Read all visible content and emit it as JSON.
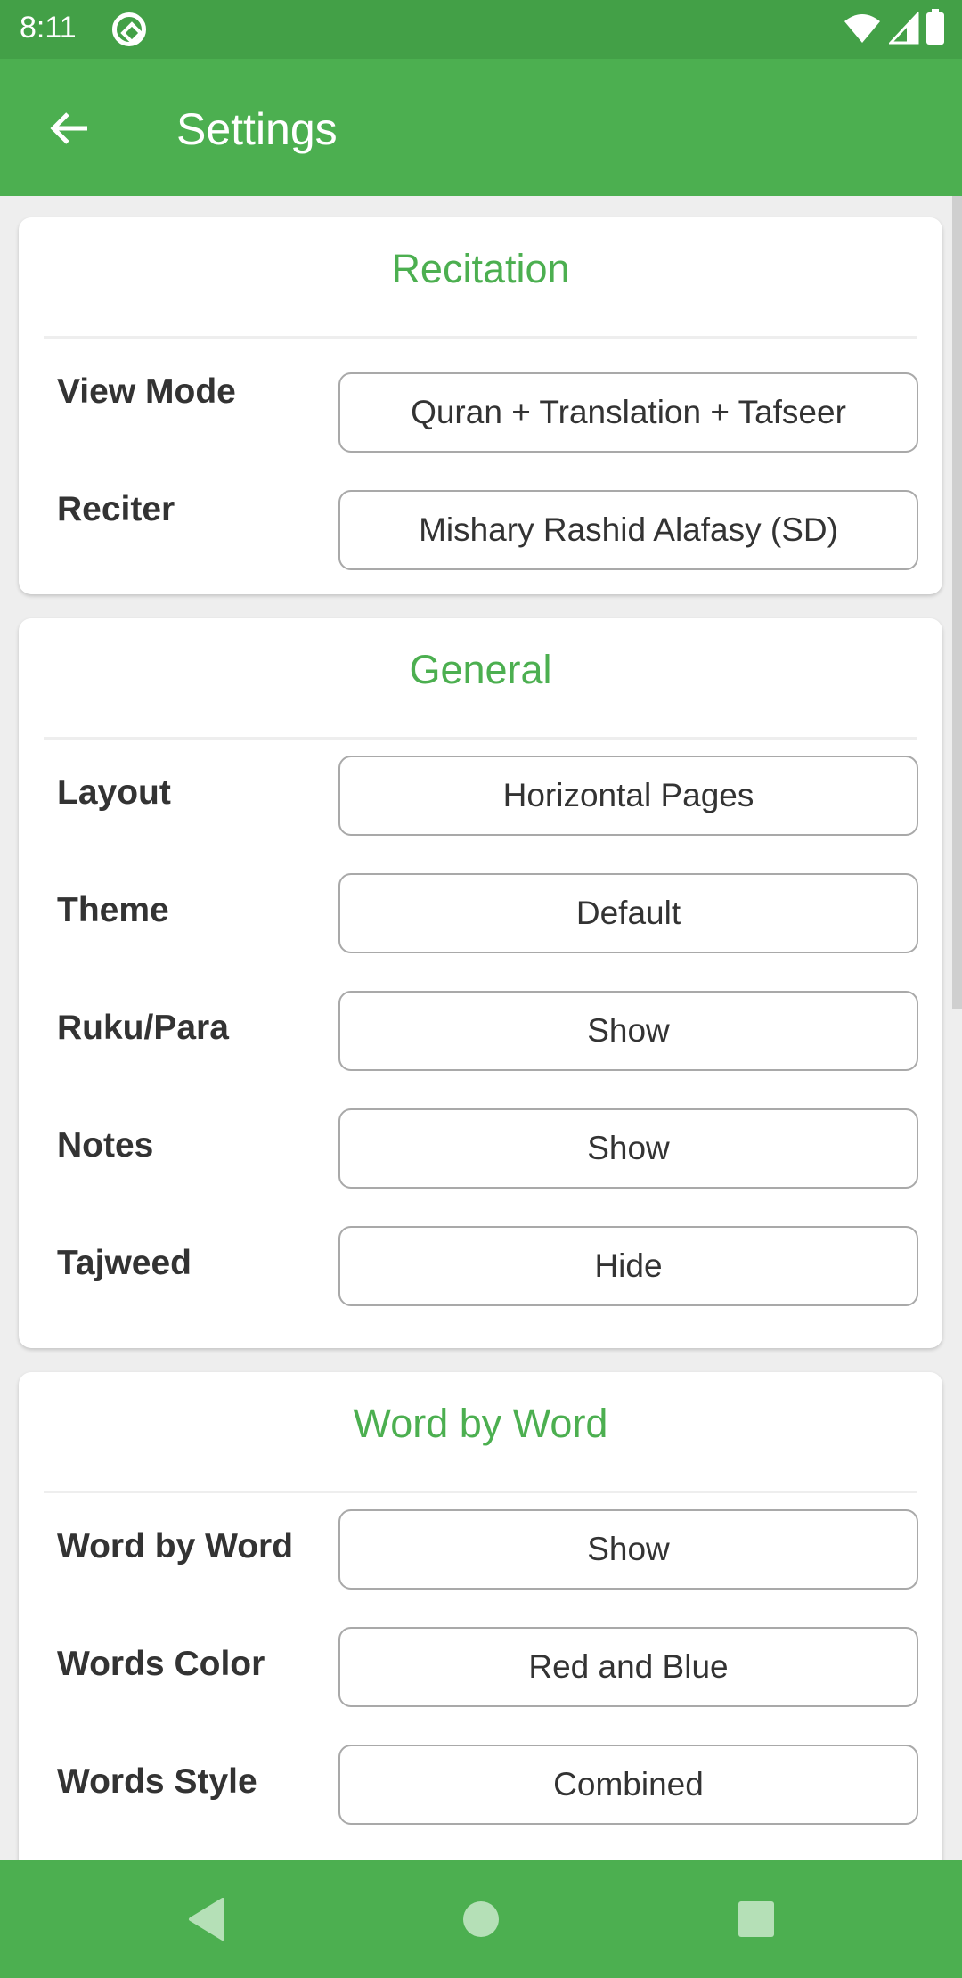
{
  "status_bar": {
    "time": "8:11",
    "icons": [
      "app-notification-icon",
      "wifi-icon",
      "signal-icon",
      "battery-icon"
    ]
  },
  "app_bar": {
    "title": "Settings",
    "back_icon": "arrow-left-icon"
  },
  "sections": [
    {
      "title": "Recitation",
      "rows": [
        {
          "label": "View Mode",
          "value": "Quran + Translation + Tafseer"
        },
        {
          "label": "Reciter",
          "value": "Mishary Rashid Alafasy (SD)"
        }
      ]
    },
    {
      "title": "General",
      "rows": [
        {
          "label": "Layout",
          "value": "Horizontal Pages"
        },
        {
          "label": "Theme",
          "value": "Default"
        },
        {
          "label": "Ruku/Para",
          "value": "Show"
        },
        {
          "label": "Notes",
          "value": "Show"
        },
        {
          "label": "Tajweed",
          "value": "Hide"
        }
      ]
    },
    {
      "title": "Word by Word",
      "rows": [
        {
          "label": "Word by Word",
          "value": "Show"
        },
        {
          "label": "Words Color",
          "value": "Red and Blue"
        },
        {
          "label": "Words Style",
          "value": "Combined"
        }
      ]
    }
  ],
  "nav_bar": {
    "buttons": [
      "back",
      "home",
      "recents"
    ]
  },
  "colors": {
    "primary": "#4caf50",
    "primary_dark": "#43a047",
    "background": "#eeeeee",
    "text": "#333333"
  }
}
